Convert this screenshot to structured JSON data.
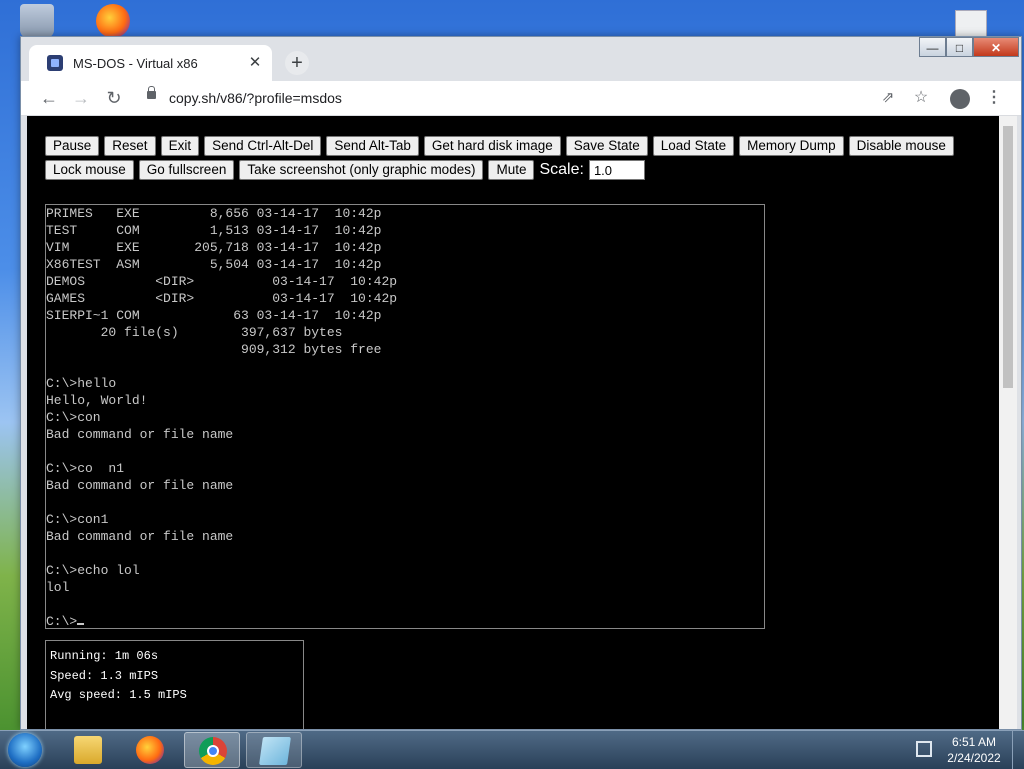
{
  "browser": {
    "tab_title": "MS-DOS - Virtual x86",
    "tab_close": "✕",
    "new_tab": "+",
    "url": "copy.sh/v86/?profile=msdos",
    "window_controls": {
      "minimize": "—",
      "maximize": "□",
      "close": "✕"
    },
    "nav": {
      "back": "←",
      "forward": "→",
      "reload": "↻",
      "share": "⇗",
      "star": "☆",
      "menu": "⋮"
    }
  },
  "controls": {
    "row1": [
      "Pause",
      "Reset",
      "Exit",
      "Send Ctrl-Alt-Del",
      "Send Alt-Tab",
      "Get hard disk image",
      "Save State",
      "Load State",
      "Memory Dump",
      "Disable mouse"
    ],
    "row2": [
      "Lock mouse",
      "Go fullscreen",
      "Take screenshot (only graphic modes)",
      "Mute"
    ],
    "scale_label": "Scale:",
    "scale_value": "1.0"
  },
  "terminal": {
    "lines": [
      "PRIMES   EXE         8,656 03-14-17  10:42p",
      "TEST     COM         1,513 03-14-17  10:42p",
      "VIM      EXE       205,718 03-14-17  10:42p",
      "X86TEST  ASM         5,504 03-14-17  10:42p",
      "DEMOS         <DIR>          03-14-17  10:42p",
      "GAMES         <DIR>          03-14-17  10:42p",
      "SIERPI~1 COM            63 03-14-17  10:42p",
      "       20 file(s)        397,637 bytes",
      "                         909,312 bytes free",
      "",
      "C:\\>hello",
      "Hello, World!",
      "C:\\>con",
      "Bad command or file name",
      "",
      "C:\\>co  n1",
      "Bad command or file name",
      "",
      "C:\\>con1",
      "Bad command or file name",
      "",
      "C:\\>echo lol",
      "lol",
      "",
      "C:\\>"
    ]
  },
  "stats": {
    "running": "Running: 1m 06s",
    "speed": "Speed: 1.3 mIPS",
    "avg_speed": "Avg speed: 1.5 mIPS"
  },
  "taskbar": {
    "time": "6:51 AM",
    "date": "2/24/2022"
  }
}
